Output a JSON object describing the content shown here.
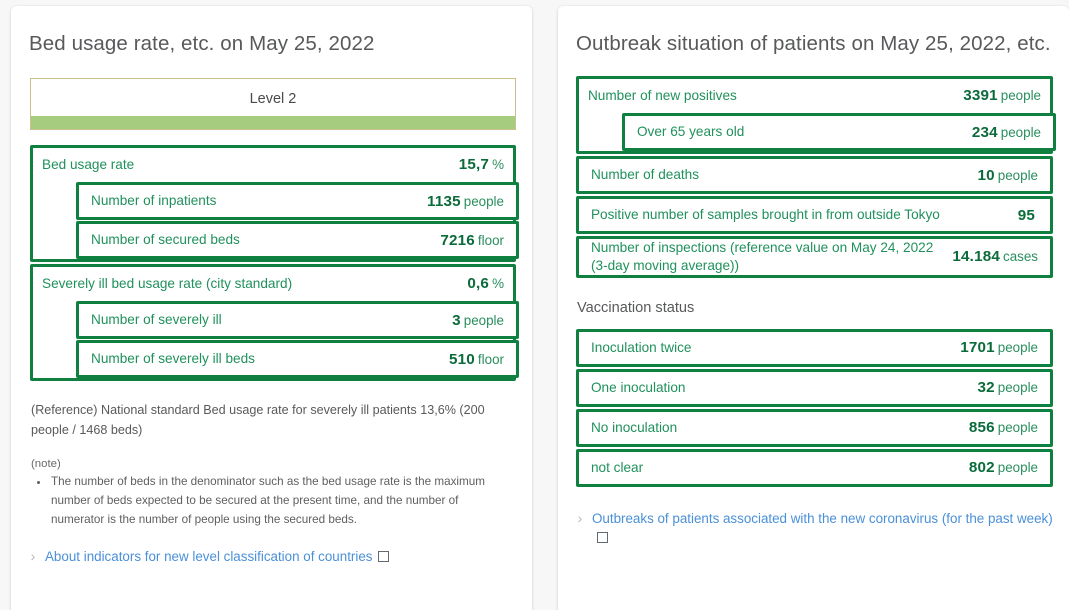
{
  "theme": {
    "green_border": "#0f8040",
    "green_value": "#0b6b3a",
    "green_label": "#20915c",
    "level_bar": "#a6cc7f",
    "level_border": "#c9c08a",
    "link_blue": "#4a90d9",
    "page_bg": "#f7f7f7"
  },
  "left_card": {
    "title": "Bed usage rate, etc. on May 25, 2022",
    "level": {
      "label": "Level 2"
    },
    "groups": [
      {
        "label": "Bed usage rate",
        "value": "15,7",
        "unit": "%",
        "children": [
          {
            "label": "Number of inpatients",
            "value": "1135",
            "unit": "people"
          },
          {
            "label": "Number of secured beds",
            "value": "7216",
            "unit": "floor"
          }
        ]
      },
      {
        "label": "Severely ill bed usage rate (city standard)",
        "value": "0,6",
        "unit": "%",
        "children": [
          {
            "label": "Number of severely ill",
            "value": "3",
            "unit": "people"
          },
          {
            "label": "Number of severely ill beds",
            "value": "510",
            "unit": "floor"
          }
        ]
      }
    ],
    "reference": "(Reference) National standard Bed usage rate for severely ill patients 13,6% (200 people / 1468 beds)",
    "note_head": "(note)",
    "notes": [
      "The number of beds in the denominator such as the bed usage rate is the maximum number of beds expected to be secured at the present time, and the number of numerator is the number of people using the secured beds."
    ],
    "link": {
      "text": "About indicators for new level classification of countries",
      "chevron": "›",
      "external_icon": "external-link-icon"
    }
  },
  "right_card": {
    "title": "Outbreak situation of patients on May 25, 2022, etc.",
    "groups": [
      {
        "label": "Number of new positives",
        "value": "3391",
        "unit": "people",
        "children": [
          {
            "label": "Over 65 years old",
            "value": "234",
            "unit": "people"
          }
        ]
      }
    ],
    "rows": [
      {
        "label": "Number of deaths",
        "value": "10",
        "unit": "people"
      },
      {
        "label": "Positive number of samples brought in from outside Tokyo",
        "value": "95",
        "unit": ""
      },
      {
        "label": "Number of inspections (reference value on May 24, 2022 (3-day moving average))",
        "value": "14.184",
        "unit": "cases"
      }
    ],
    "vaccination": {
      "heading": "Vaccination status",
      "rows": [
        {
          "label": "Inoculation twice",
          "value": "1701",
          "unit": "people"
        },
        {
          "label": "One inoculation",
          "value": "32",
          "unit": "people"
        },
        {
          "label": "No inoculation",
          "value": "856",
          "unit": "people"
        },
        {
          "label": "not clear",
          "value": "802",
          "unit": "people"
        }
      ]
    },
    "link": {
      "text": "Outbreaks of patients associated with the new coronavirus (for the past week)",
      "chevron": "›",
      "external_icon": "external-link-icon"
    }
  }
}
